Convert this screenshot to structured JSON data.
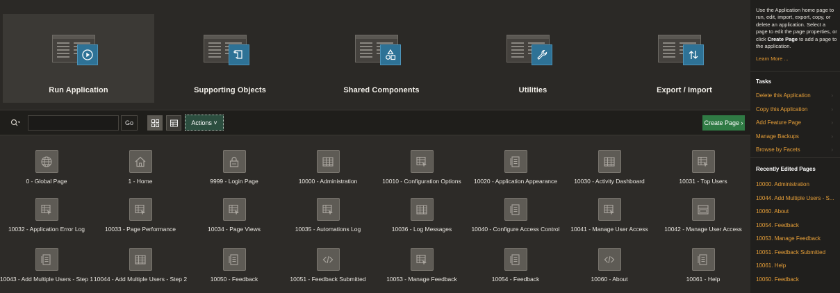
{
  "top_tiles": [
    {
      "label": "Run Application",
      "icon": "play-circle-icon",
      "active": true
    },
    {
      "label": "Supporting Objects",
      "icon": "scroll-icon",
      "active": false
    },
    {
      "label": "Shared Components",
      "icon": "shapes-icon",
      "active": false
    },
    {
      "label": "Utilities",
      "icon": "wrench-icon",
      "active": false
    },
    {
      "label": "Export / Import",
      "icon": "arrows-up-down-icon",
      "active": false
    }
  ],
  "toolbar": {
    "search_value": "",
    "go_label": "Go",
    "actions_label": "Actions ˅",
    "create_page_label": "Create Page ›"
  },
  "pages": [
    {
      "label": "0 - Global Page",
      "icon": "globe-icon"
    },
    {
      "label": "1 - Home",
      "icon": "home-icon"
    },
    {
      "label": "9999 - Login Page",
      "icon": "lock-icon"
    },
    {
      "label": "10000 - Administration",
      "icon": "grid-icon"
    },
    {
      "label": "10010 - Configuration Options",
      "icon": "report-icon"
    },
    {
      "label": "10020 - Application Appearance",
      "icon": "form-icon"
    },
    {
      "label": "10030 - Activity Dashboard",
      "icon": "grid-icon"
    },
    {
      "label": "10031 - Top Users",
      "icon": "report-icon"
    },
    {
      "label": "10032 - Application Error Log",
      "icon": "report-icon"
    },
    {
      "label": "10033 - Page Performance",
      "icon": "report-icon"
    },
    {
      "label": "10034 - Page Views",
      "icon": "report-icon"
    },
    {
      "label": "10035 - Automations Log",
      "icon": "report-icon"
    },
    {
      "label": "10036 - Log Messages",
      "icon": "grid-icon"
    },
    {
      "label": "10040 - Configure Access Control",
      "icon": "form-icon"
    },
    {
      "label": "10041 - Manage User Access",
      "icon": "report-icon"
    },
    {
      "label": "10042 - Manage User Access",
      "icon": "window-icon"
    },
    {
      "label": "10043 - Add Multiple Users - Step 1",
      "icon": "form-icon"
    },
    {
      "label": "10044 - Add Multiple Users - Step 2",
      "icon": "grid-icon"
    },
    {
      "label": "10050 - Feedback",
      "icon": "form-icon"
    },
    {
      "label": "10051 - Feedback Submitted",
      "icon": "code-icon"
    },
    {
      "label": "10053 - Manage Feedback",
      "icon": "report-icon"
    },
    {
      "label": "10054 - Feedback",
      "icon": "form-icon"
    },
    {
      "label": "10060 - About",
      "icon": "code-icon"
    },
    {
      "label": "10061 - Help",
      "icon": "form-icon"
    }
  ],
  "sidebar": {
    "intro_start": "Use the Application home page to run, edit, import, export, copy, or delete an application. Select a page to edit the page properties, or click ",
    "intro_strong": "Create Page",
    "intro_end": " to add a page to the application.",
    "learn_more": "Learn More ...",
    "tasks_heading": "Tasks",
    "tasks": [
      "Delete this Application",
      "Copy this Application",
      "Add Feature Page",
      "Manage Backups",
      "Browse by Facets"
    ],
    "recent_heading": "Recently Edited Pages",
    "recent": [
      "10000. Administration",
      "10044. Add Multiple Users - S...",
      "10060. About",
      "10054. Feedback",
      "10053. Manage Feedback",
      "10051. Feedback Submitted",
      "10061. Help",
      "10050. Feedback"
    ]
  },
  "colors": {
    "background": "#2d2b28",
    "sidebar_bg": "#201f1d",
    "accent_blue": "#2e7296",
    "create_green": "#2f7a44",
    "link_orange": "#e69f38"
  }
}
